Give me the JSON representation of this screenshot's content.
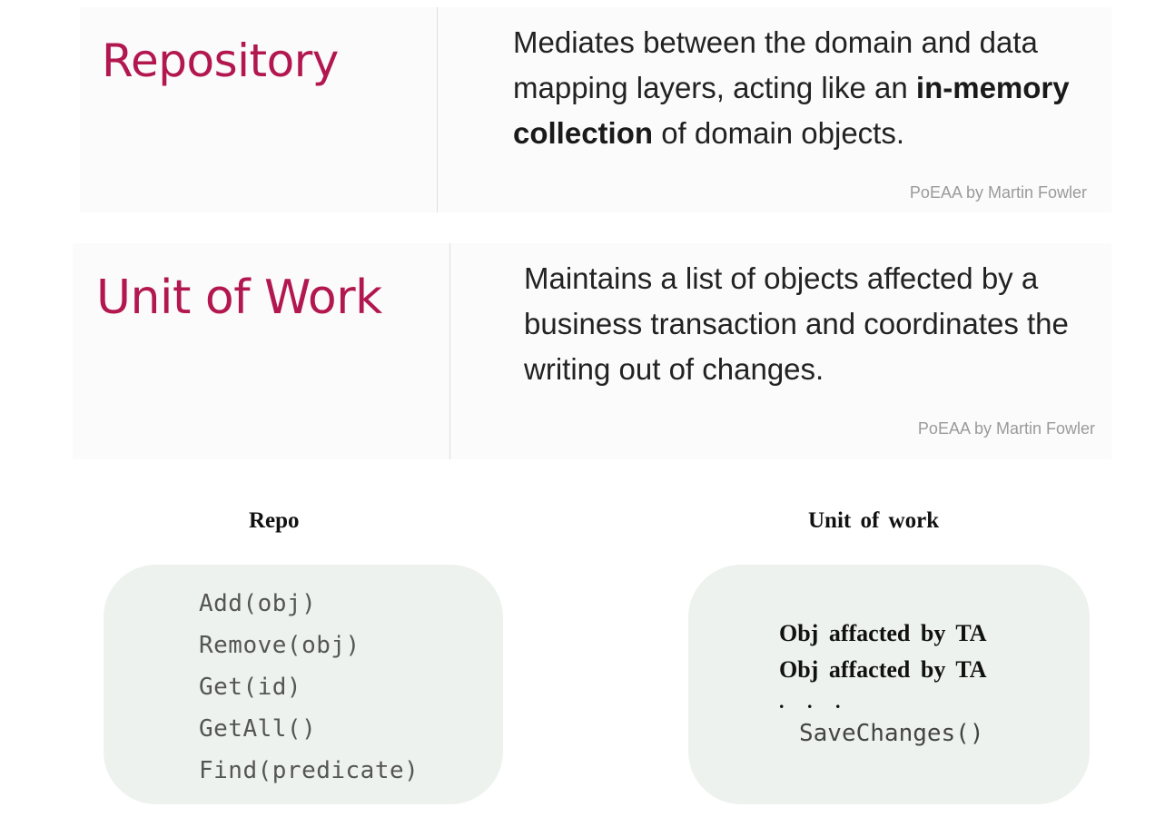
{
  "repository_slide": {
    "term": "Repository",
    "definition": {
      "before": "Mediates between the domain and data mapping layers, acting like an ",
      "bold": "in-memory collection",
      "after": " of domain objects."
    },
    "source": "PoEAA by Martin Fowler"
  },
  "unit_of_work_slide": {
    "term": "Unit of Work",
    "definition": "Maintains a list of objects affected by a business transaction and coordinates the writing out of changes.",
    "source": "PoEAA by Martin Fowler"
  },
  "repo_column": {
    "title": "Repo",
    "methods": [
      "Add(obj)",
      "Remove(obj)",
      "Get(id)",
      "GetAll()",
      "Find(predicate)"
    ]
  },
  "uow_column": {
    "title": "Unit of work",
    "lines": [
      "Obj affacted by TA",
      "Obj affacted by TA"
    ],
    "ellipsis": ". . .",
    "method": "SaveChanges()"
  },
  "colors": {
    "term": "#b2174f",
    "panel_background": "#edf2ee",
    "slide_background": "#fbfbfb",
    "source_text": "#9a9a9a"
  }
}
